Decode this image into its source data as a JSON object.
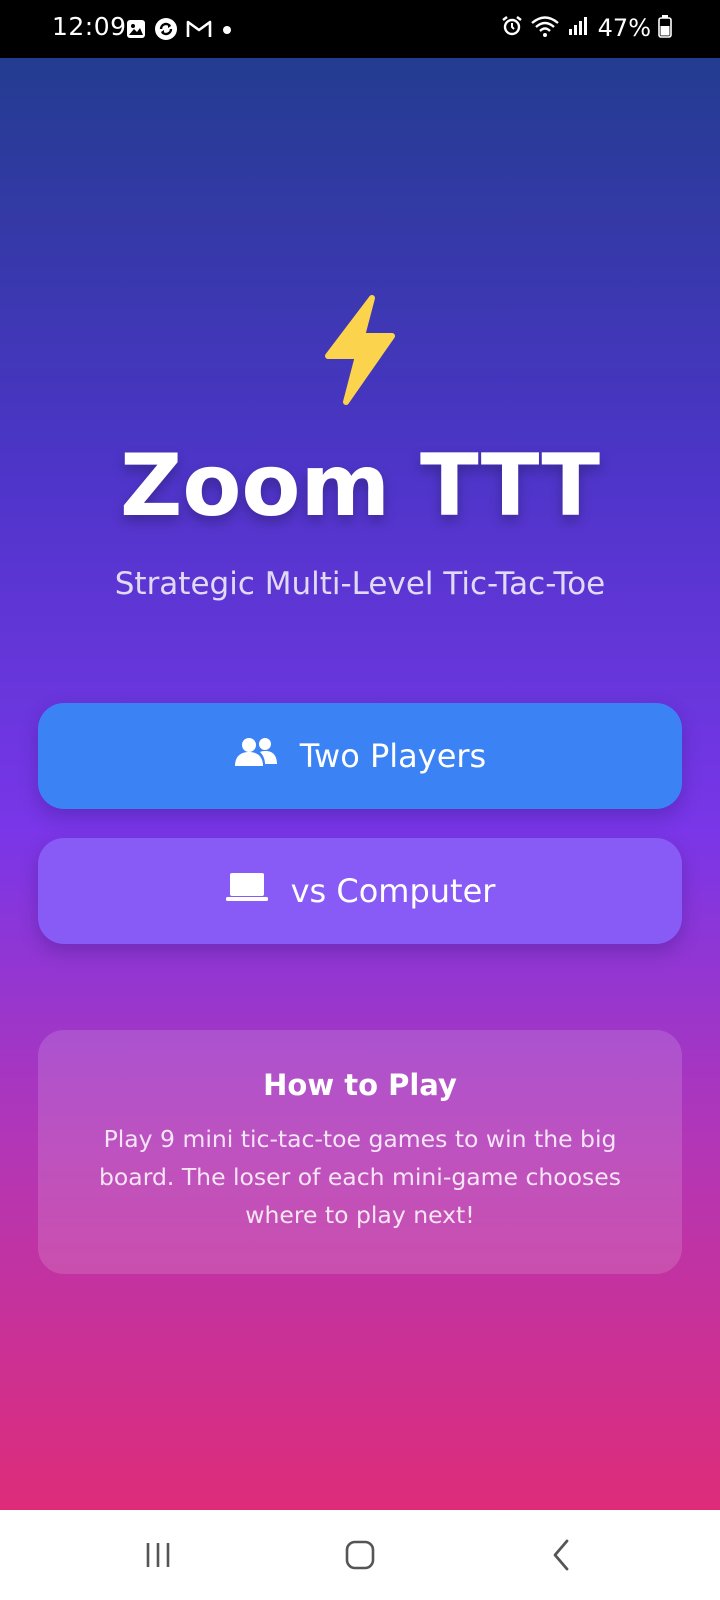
{
  "status_bar": {
    "time": "12:09",
    "battery": "47%",
    "left_icons": [
      "gallery-icon",
      "sync-icon",
      "gmail-icon",
      "notification-dot-icon"
    ],
    "right_icons": [
      "alarm-icon",
      "wifi-icon",
      "signal-icon",
      "battery-icon"
    ]
  },
  "app": {
    "logo_icon": "lightning-bolt-icon",
    "title": "Zoom TTT",
    "subtitle": "Strategic Multi-Level Tic-Tac-Toe"
  },
  "buttons": {
    "two_players": {
      "label": "Two Players",
      "icon": "users-icon"
    },
    "vs_computer": {
      "label": "vs Computer",
      "icon": "laptop-icon"
    }
  },
  "how_to_play": {
    "title": "How to Play",
    "body": "Play 9 mini tic-tac-toe games to win the big board. The loser of each mini-game chooses where to play next!"
  },
  "nav_bar": {
    "items": [
      "recent-apps-icon",
      "home-icon",
      "back-icon"
    ]
  },
  "colors": {
    "gradient_top": "#233c90",
    "gradient_mid": "#7936e8",
    "gradient_bottom": "#de2c79",
    "two_players_button": "#3b82f4",
    "vs_computer_button": "#885af6",
    "bolt": "#fcd34d"
  }
}
